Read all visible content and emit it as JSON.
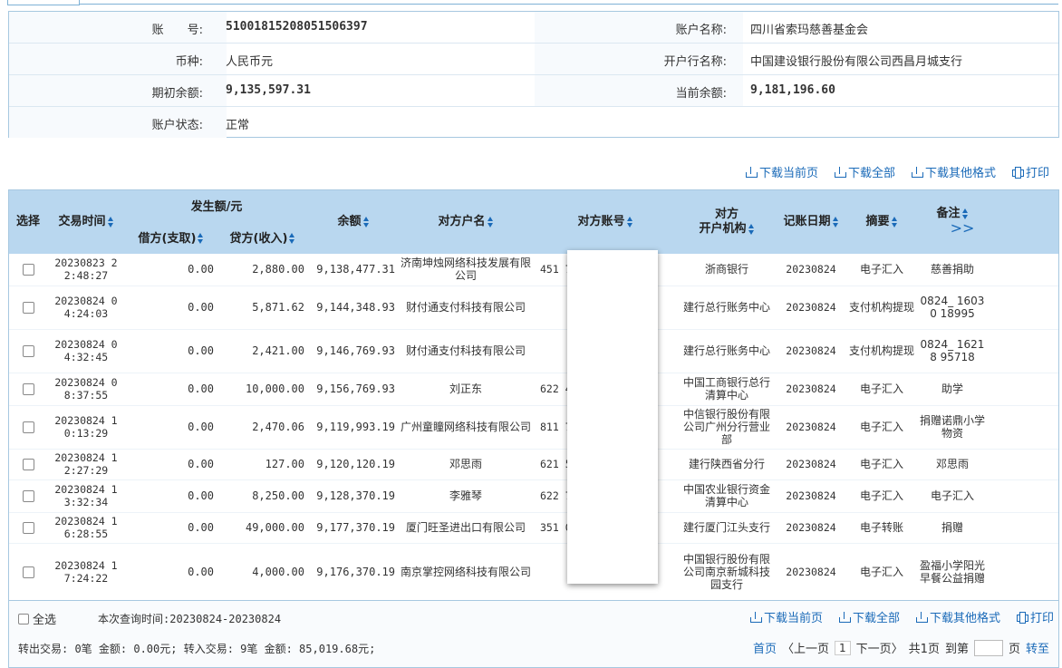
{
  "account": {
    "account_no_label": "账　　号:",
    "account_no": "51001815208051506397",
    "account_name_label": "账户名称:",
    "account_name": "四川省索玛慈善基金会",
    "currency_label": "币种:",
    "currency": "人民币元",
    "bank_label": "开户行名称:",
    "bank": "中国建设银行股份有限公司西昌月城支行",
    "opening_balance_label": "期初余额:",
    "opening_balance": "9,135,597.31",
    "current_balance_label": "当前余额:",
    "current_balance": "9,181,196.60",
    "status_label": "账户状态:",
    "status": "正常"
  },
  "downloads": {
    "current_page": "下载当前页",
    "all": "下载全部",
    "other_formats": "下载其他格式",
    "print": "打印"
  },
  "table": {
    "headers": {
      "select": "选择",
      "time": "交易时间",
      "amount_group": "发生额/元",
      "debit": "借方(支取)",
      "credit": "贷方(收入)",
      "balance": "余额",
      "counterparty_name": "对方户名",
      "counterparty_account": "对方账号",
      "counterparty_bank": "对方\n开户机构",
      "post_date": "记账日期",
      "summary": "摘要",
      "remark": "备注",
      "more": ">>"
    },
    "rows": [
      {
        "time": "20230823 22:48:27",
        "debit": "0.00",
        "credit": "2,880.00",
        "balance": "9,138,477.31",
        "name": "济南坤烛网络科技发展有限公司",
        "account": "451                     778",
        "bank": "浙商银行",
        "date": "20230824",
        "summary": "电子汇入",
        "remark": "慈善捐助"
      },
      {
        "time": "20230824 04:24:03",
        "debit": "0.00",
        "credit": "5,871.62",
        "balance": "9,144,348.93",
        "name": "财付通支付科技有限公司",
        "account": "",
        "bank": "建行总行账务中心",
        "date": "20230824",
        "summary": "支付机构提现",
        "remark": "0824_ 16030 18995"
      },
      {
        "time": "20230824 04:32:45",
        "debit": "0.00",
        "credit": "2,421.00",
        "balance": "9,146,769.93",
        "name": "财付通支付科技有限公司",
        "account": "",
        "bank": "建行总行账务中心",
        "date": "20230824",
        "summary": "支付机构提现",
        "remark": "0824_ 16218 95718"
      },
      {
        "time": "20230824 08:37:55",
        "debit": "0.00",
        "credit": "10,000.00",
        "balance": "9,156,769.93",
        "name": "刘正东",
        "account": "622                     40",
        "bank": "中国工商银行总行清算中心",
        "date": "20230824",
        "summary": "电子汇入",
        "remark": "助学"
      },
      {
        "time": "20230824 10:13:29",
        "debit": "0.00",
        "credit": "2,470.06",
        "balance": "9,119,993.19",
        "name": "广州童瞳网络科技有限公司",
        "account": "811                     76",
        "bank": "中信银行股份有限公司广州分行营业部",
        "date": "20230824",
        "summary": "电子汇入",
        "remark": "捐赠诺鼎小学物资"
      },
      {
        "time": "20230824 12:27:29",
        "debit": "0.00",
        "credit": "127.00",
        "balance": "9,120,120.19",
        "name": "邓思雨",
        "account": "621                     54",
        "bank": "建行陕西省分行",
        "date": "20230824",
        "summary": "电子汇入",
        "remark": "邓思雨"
      },
      {
        "time": "20230824 13:32:34",
        "debit": "0.00",
        "credit": "8,250.00",
        "balance": "9,128,370.19",
        "name": "李雅琴",
        "account": "622                     79",
        "bank": "中国农业银行资金清算中心",
        "date": "20230824",
        "summary": "电子汇入",
        "remark": "电子汇入"
      },
      {
        "time": "20230824 16:28:55",
        "debit": "0.00",
        "credit": "49,000.00",
        "balance": "9,177,370.19",
        "name": "厦门旺圣进出口有限公司",
        "account": "351                     07",
        "bank": "建行厦门江头支行",
        "date": "20230824",
        "summary": "电子转账",
        "remark": "捐赠"
      },
      {
        "time": "20230824 17:24:22",
        "debit": "0.00",
        "credit": "4,000.00",
        "balance": "9,176,370.19",
        "name": "南京掌控网络科技有限公司",
        "account": "",
        "bank": "中国银行股份有限公司南京新城科技园支行",
        "date": "20230824",
        "summary": "电子汇入",
        "remark": "盈福小学阳光早餐公益捐赠"
      }
    ]
  },
  "footer": {
    "select_all": "全选",
    "query_period": "本次查询时间:20230824-20230824",
    "summary_line": "转出交易: 0笔   金额: 0.00元;   转入交易: 9笔   金额: 85,019.68元;",
    "pager": {
      "first": "首页",
      "prev": "〈上一页",
      "current": "1",
      "next": "下一页〉",
      "total": "共1页",
      "goto": "到第",
      "page_unit": "页",
      "go": "转至"
    }
  }
}
